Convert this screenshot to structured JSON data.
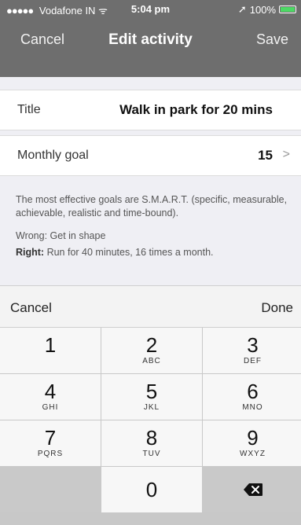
{
  "status": {
    "signal_dots": "●●●●●",
    "carrier": "Vodafone IN",
    "wifi_glyph": "ᯤ",
    "time": "5:04 pm",
    "location_glyph": "➚",
    "battery": "100%"
  },
  "nav": {
    "cancel": "Cancel",
    "title": "Edit activity",
    "save": "Save"
  },
  "form": {
    "title_label": "Title",
    "title_value": "Walk in park for 20 mins",
    "goal_label": "Monthly goal",
    "goal_value": "15",
    "goal_chevron": ">"
  },
  "help": {
    "text": "The most effective goals are S.M.A.R.T. (specific, measurable, achievable, realistic and time-bound).",
    "wrong": "Wrong: Get in shape",
    "right_label": "Right:",
    "right_text": " Run for 40 minutes, 16 times a month."
  },
  "keyboard": {
    "cancel": "Cancel",
    "done": "Done",
    "keys": [
      {
        "num": "1",
        "letters": ""
      },
      {
        "num": "2",
        "letters": "ABC"
      },
      {
        "num": "3",
        "letters": "DEF"
      },
      {
        "num": "4",
        "letters": "GHI"
      },
      {
        "num": "5",
        "letters": "JKL"
      },
      {
        "num": "6",
        "letters": "MNO"
      },
      {
        "num": "7",
        "letters": "PQRS"
      },
      {
        "num": "8",
        "letters": "TUV"
      },
      {
        "num": "9",
        "letters": "WXYZ"
      },
      {
        "num": "0",
        "letters": ""
      }
    ],
    "delete_icon": "backspace-icon"
  },
  "colors": {
    "nav_bg": "#6e6e6e",
    "battery_fill": "#4cd964"
  }
}
